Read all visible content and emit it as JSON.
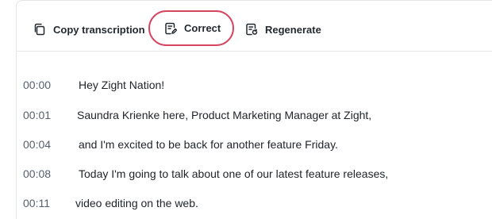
{
  "toolbar": {
    "copy_label": "Copy transcription",
    "correct_label": "Correct",
    "regenerate_label": "Regenerate"
  },
  "transcript": [
    {
      "time": "00:00",
      "text": "Hey Zight Nation!"
    },
    {
      "time": "00:01",
      "text": "Saundra Krienke here, Product Marketing Manager at Zight,"
    },
    {
      "time": "00:04",
      "text": "and I'm excited to be back for another feature Friday."
    },
    {
      "time": "00:08",
      "text": "Today I'm going to talk about one of our latest feature releases,"
    },
    {
      "time": "00:11",
      "text": "video editing on the web."
    }
  ],
  "colors": {
    "highlight_ring": "#d6455f",
    "divider": "#e6e7ea",
    "timestamp": "#57606a"
  },
  "icons": {
    "copy": "copy-icon",
    "correct": "edit-document-icon",
    "regenerate": "regenerate-document-icon"
  }
}
